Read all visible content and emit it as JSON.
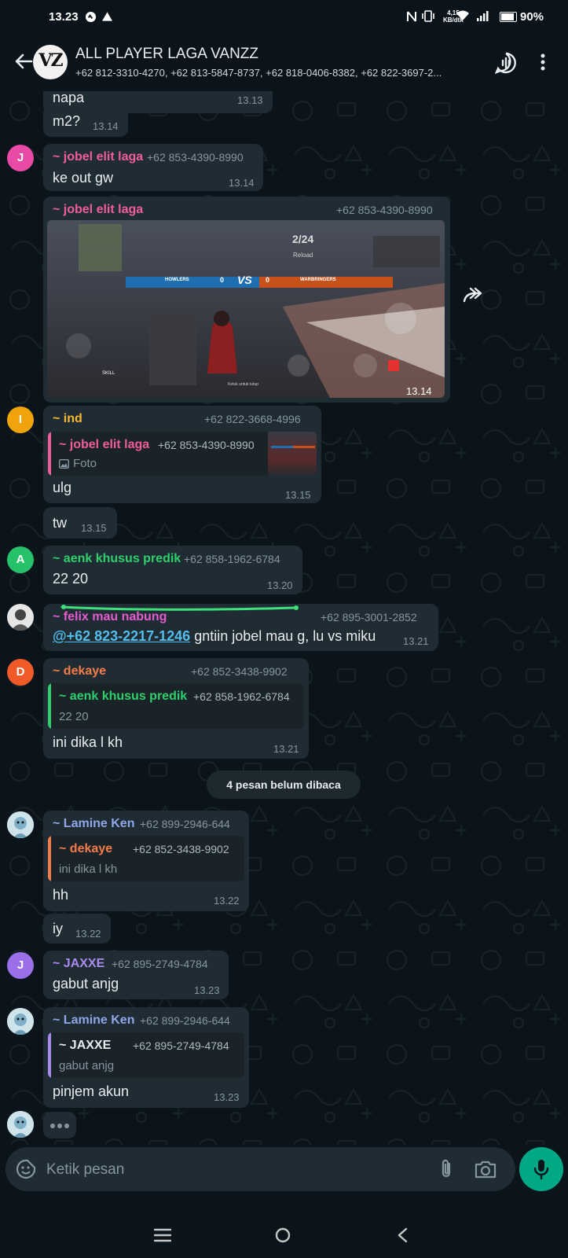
{
  "status_bar": {
    "time": "13.23",
    "network_speed": "4,15",
    "network_speed_unit": "KB/dtk",
    "battery": "90%",
    "icons": [
      "whatsapp-status-icon",
      "warning-icon",
      "nfc-icon",
      "vibrate-icon",
      "wifi-icon",
      "signal-icon",
      "battery-icon"
    ]
  },
  "header": {
    "title": "ALL PLAYER LAGA VANZZ",
    "avatar_text": "VZ",
    "members": "+62 812-3310-4270, +62 813-5847-8737, +62 818-0406-8382, +62 822-3697-2..."
  },
  "colors": {
    "background": "#0b141a",
    "bubble": "#202c33",
    "accent": "#00a884",
    "mention": "#53bdeb"
  },
  "messages": [
    {
      "id": "m1",
      "text": "napa",
      "time": "13.13"
    },
    {
      "id": "m2",
      "text": "m2?",
      "time": "13.14"
    },
    {
      "id": "m3",
      "avatar": "J",
      "avatar_color": "#e84aa6",
      "sender": "~ jobel elit laga",
      "sender_color": "#f15c9c",
      "phone": "+62 853-4390-8990",
      "text": "ke out gw",
      "time": "13.14"
    },
    {
      "id": "m4",
      "sender": "~ jobel elit laga",
      "sender_color": "#f15c9c",
      "phone": "+62 853-4390-8990",
      "type": "image",
      "time": "13.14",
      "image": {
        "team_left": "HOWLERS",
        "team_right": "WARBRINGERS",
        "score_left": "0",
        "score_right": "0",
        "vs": "VS",
        "reload": "Reload",
        "ammo": "2/24",
        "skill": "SKILL",
        "tap_hint": "Ketuk untuk tutup"
      }
    },
    {
      "id": "m5",
      "avatar": "I",
      "avatar_color": "#f0a30a",
      "sender": "~ ind",
      "sender_color": "#f7b731",
      "phone": "+62 822-3668-4996",
      "quote": {
        "name": "~ jobel elit laga",
        "name_color": "#f15c9c",
        "phone": "+62 853-4390-8990",
        "text": "Foto"
      },
      "text": "ulg",
      "time": "13.15"
    },
    {
      "id": "m6",
      "text": "tw",
      "time": "13.15"
    },
    {
      "id": "m7",
      "avatar": "A",
      "avatar_color": "#25c26a",
      "sender": "~ aenk khusus predik",
      "sender_color": "#2fcf6d",
      "phone": "+62 858-1962-6784",
      "text": "22 20",
      "time": "13.20"
    },
    {
      "id": "m8",
      "sender": "~ felix mau nabung",
      "sender_color": "#e45ccf",
      "phone": "+62 895-3001-2852",
      "mention": "@+62 823-2217-1246",
      "text": " gntiin jobel mau g, lu vs miku",
      "time": "13.21"
    },
    {
      "id": "m9",
      "avatar": "D",
      "avatar_color": "#f05a28",
      "sender": "~ dekaye",
      "sender_color": "#f57c4a",
      "phone": "+62 852-3438-9902",
      "quote": {
        "name": "~ aenk khusus predik",
        "name_color": "#2fcf6d",
        "phone": "+62 858-1962-6784",
        "text": "22 20"
      },
      "text": "ini dika l kh",
      "time": "13.21"
    },
    {
      "id": "m10",
      "sender": "~ Lamine Ken",
      "sender_color": "#8fa7e8",
      "phone": "+62 899-2946-644",
      "quote": {
        "name": "~ dekaye",
        "name_color": "#f57c4a",
        "phone": "+62 852-3438-9902",
        "text": "ini dika l kh"
      },
      "text": "hh",
      "time": "13.22"
    },
    {
      "id": "m11",
      "text": "iy",
      "time": "13.22"
    },
    {
      "id": "m12",
      "avatar": "J",
      "avatar_color": "#9b6fe8",
      "sender": "~ JAXXE",
      "sender_color": "#a98bf0",
      "phone": "+62 895-2749-4784",
      "text": "gabut anjg",
      "time": "13.23"
    },
    {
      "id": "m13",
      "sender": "~ Lamine Ken",
      "sender_color": "#8fa7e8",
      "phone": "+62 899-2946-644",
      "quote": {
        "name": "~ JAXXE",
        "name_color": "#e9edef",
        "phone": "+62 895-2749-4784",
        "text": "gabut anjg"
      },
      "text": "pinjem akun",
      "time": "13.23"
    }
  ],
  "unread_divider": "4 pesan belum dibaca",
  "composer": {
    "placeholder": "Ketik pesan"
  },
  "nav_icons": [
    "recent-apps-icon",
    "home-icon",
    "back-nav-icon"
  ]
}
